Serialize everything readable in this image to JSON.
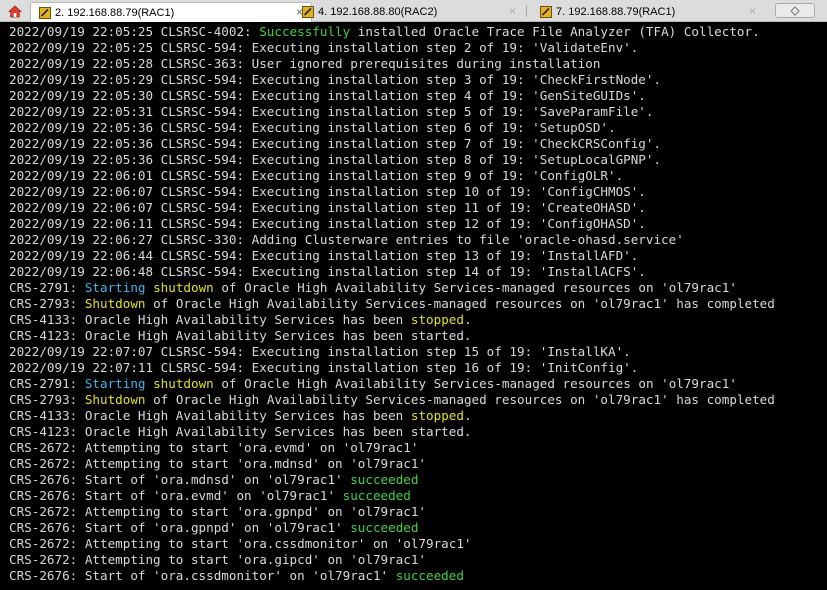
{
  "tabs": [
    {
      "label": "2. 192.168.88.79(RAC1)",
      "active": true,
      "close": "×"
    },
    {
      "label": "4. 192.168.88.80(RAC2)",
      "active": false,
      "close": "×"
    },
    {
      "label": "7. 192.168.88.79(RAC1)",
      "active": false,
      "close": "×"
    }
  ],
  "colors": {
    "success": "#3fd23f",
    "warning": "#e2e21c",
    "info": "#3bb8e8",
    "text": "#d8d8d8",
    "background": "#000000"
  },
  "terminal": {
    "lines": [
      [
        {
          "t": "2022/09/19 22:05:25 CLSRSC-4002: "
        },
        {
          "t": "Successfully",
          "c": "g"
        },
        {
          "t": " installed Oracle Trace File Analyzer (TFA) Collector."
        }
      ],
      [
        {
          "t": "2022/09/19 22:05:25 CLSRSC-594: Executing installation step 2 of 19: 'ValidateEnv'."
        }
      ],
      [
        {
          "t": "2022/09/19 22:05:28 CLSRSC-363: User ignored prerequisites during installation"
        }
      ],
      [
        {
          "t": "2022/09/19 22:05:29 CLSRSC-594: Executing installation step 3 of 19: 'CheckFirstNode'."
        }
      ],
      [
        {
          "t": "2022/09/19 22:05:30 CLSRSC-594: Executing installation step 4 of 19: 'GenSiteGUIDs'."
        }
      ],
      [
        {
          "t": "2022/09/19 22:05:31 CLSRSC-594: Executing installation step 5 of 19: 'SaveParamFile'."
        }
      ],
      [
        {
          "t": "2022/09/19 22:05:36 CLSRSC-594: Executing installation step 6 of 19: 'SetupOSD'."
        }
      ],
      [
        {
          "t": "2022/09/19 22:05:36 CLSRSC-594: Executing installation step 7 of 19: 'CheckCRSConfig'."
        }
      ],
      [
        {
          "t": "2022/09/19 22:05:36 CLSRSC-594: Executing installation step 8 of 19: 'SetupLocalGPNP'."
        }
      ],
      [
        {
          "t": "2022/09/19 22:06:01 CLSRSC-594: Executing installation step 9 of 19: 'ConfigOLR'."
        }
      ],
      [
        {
          "t": "2022/09/19 22:06:07 CLSRSC-594: Executing installation step 10 of 19: 'ConfigCHMOS'."
        }
      ],
      [
        {
          "t": "2022/09/19 22:06:07 CLSRSC-594: Executing installation step 11 of 19: 'CreateOHASD'."
        }
      ],
      [
        {
          "t": "2022/09/19 22:06:11 CLSRSC-594: Executing installation step 12 of 19: 'ConfigOHASD'."
        }
      ],
      [
        {
          "t": "2022/09/19 22:06:27 CLSRSC-330: Adding Clusterware entries to file 'oracle-ohasd.service'"
        }
      ],
      [
        {
          "t": "2022/09/19 22:06:44 CLSRSC-594: Executing installation step 13 of 19: 'InstallAFD'."
        }
      ],
      [
        {
          "t": "2022/09/19 22:06:48 CLSRSC-594: Executing installation step 14 of 19: 'InstallACFS'."
        }
      ],
      [
        {
          "t": "CRS-2791: "
        },
        {
          "t": "Starting",
          "c": "b"
        },
        {
          "t": " "
        },
        {
          "t": "shutdown",
          "c": "y"
        },
        {
          "t": " of Oracle High Availability Services-managed resources on 'ol79rac1'"
        }
      ],
      [
        {
          "t": "CRS-2793: "
        },
        {
          "t": "Shutdown",
          "c": "y"
        },
        {
          "t": " of Oracle High Availability Services-managed resources on 'ol79rac1' has completed"
        }
      ],
      [
        {
          "t": "CRS-4133: Oracle High Availability Services has been "
        },
        {
          "t": "stopped",
          "c": "y"
        },
        {
          "t": "."
        }
      ],
      [
        {
          "t": "CRS-4123: Oracle High Availability Services has been started."
        }
      ],
      [
        {
          "t": "2022/09/19 22:07:07 CLSRSC-594: Executing installation step 15 of 19: 'InstallKA'."
        }
      ],
      [
        {
          "t": "2022/09/19 22:07:11 CLSRSC-594: Executing installation step 16 of 19: 'InitConfig'."
        }
      ],
      [
        {
          "t": "CRS-2791: "
        },
        {
          "t": "Starting",
          "c": "b"
        },
        {
          "t": " "
        },
        {
          "t": "shutdown",
          "c": "y"
        },
        {
          "t": " of Oracle High Availability Services-managed resources on 'ol79rac1'"
        }
      ],
      [
        {
          "t": "CRS-2793: "
        },
        {
          "t": "Shutdown",
          "c": "y"
        },
        {
          "t": " of Oracle High Availability Services-managed resources on 'ol79rac1' has completed"
        }
      ],
      [
        {
          "t": "CRS-4133: Oracle High Availability Services has been "
        },
        {
          "t": "stopped",
          "c": "y"
        },
        {
          "t": "."
        }
      ],
      [
        {
          "t": "CRS-4123: Oracle High Availability Services has been started."
        }
      ],
      [
        {
          "t": "CRS-2672: Attempting to start 'ora.evmd' on 'ol79rac1'"
        }
      ],
      [
        {
          "t": "CRS-2672: Attempting to start 'ora.mdnsd' on 'ol79rac1'"
        }
      ],
      [
        {
          "t": "CRS-2676: Start of 'ora.mdnsd' on 'ol79rac1' "
        },
        {
          "t": "succeeded",
          "c": "g"
        }
      ],
      [
        {
          "t": "CRS-2676: Start of 'ora.evmd' on 'ol79rac1' "
        },
        {
          "t": "succeeded",
          "c": "g"
        }
      ],
      [
        {
          "t": "CRS-2672: Attempting to start 'ora.gpnpd' on 'ol79rac1'"
        }
      ],
      [
        {
          "t": "CRS-2676: Start of 'ora.gpnpd' on 'ol79rac1' "
        },
        {
          "t": "succeeded",
          "c": "g"
        }
      ],
      [
        {
          "t": "CRS-2672: Attempting to start 'ora.cssdmonitor' on 'ol79rac1'"
        }
      ],
      [
        {
          "t": "CRS-2672: Attempting to start 'ora.gipcd' on 'ol79rac1'"
        }
      ],
      [
        {
          "t": "CRS-2676: Start of 'ora.cssdmonitor' on 'ol79rac1' "
        },
        {
          "t": "succeeded",
          "c": "g"
        }
      ]
    ]
  }
}
